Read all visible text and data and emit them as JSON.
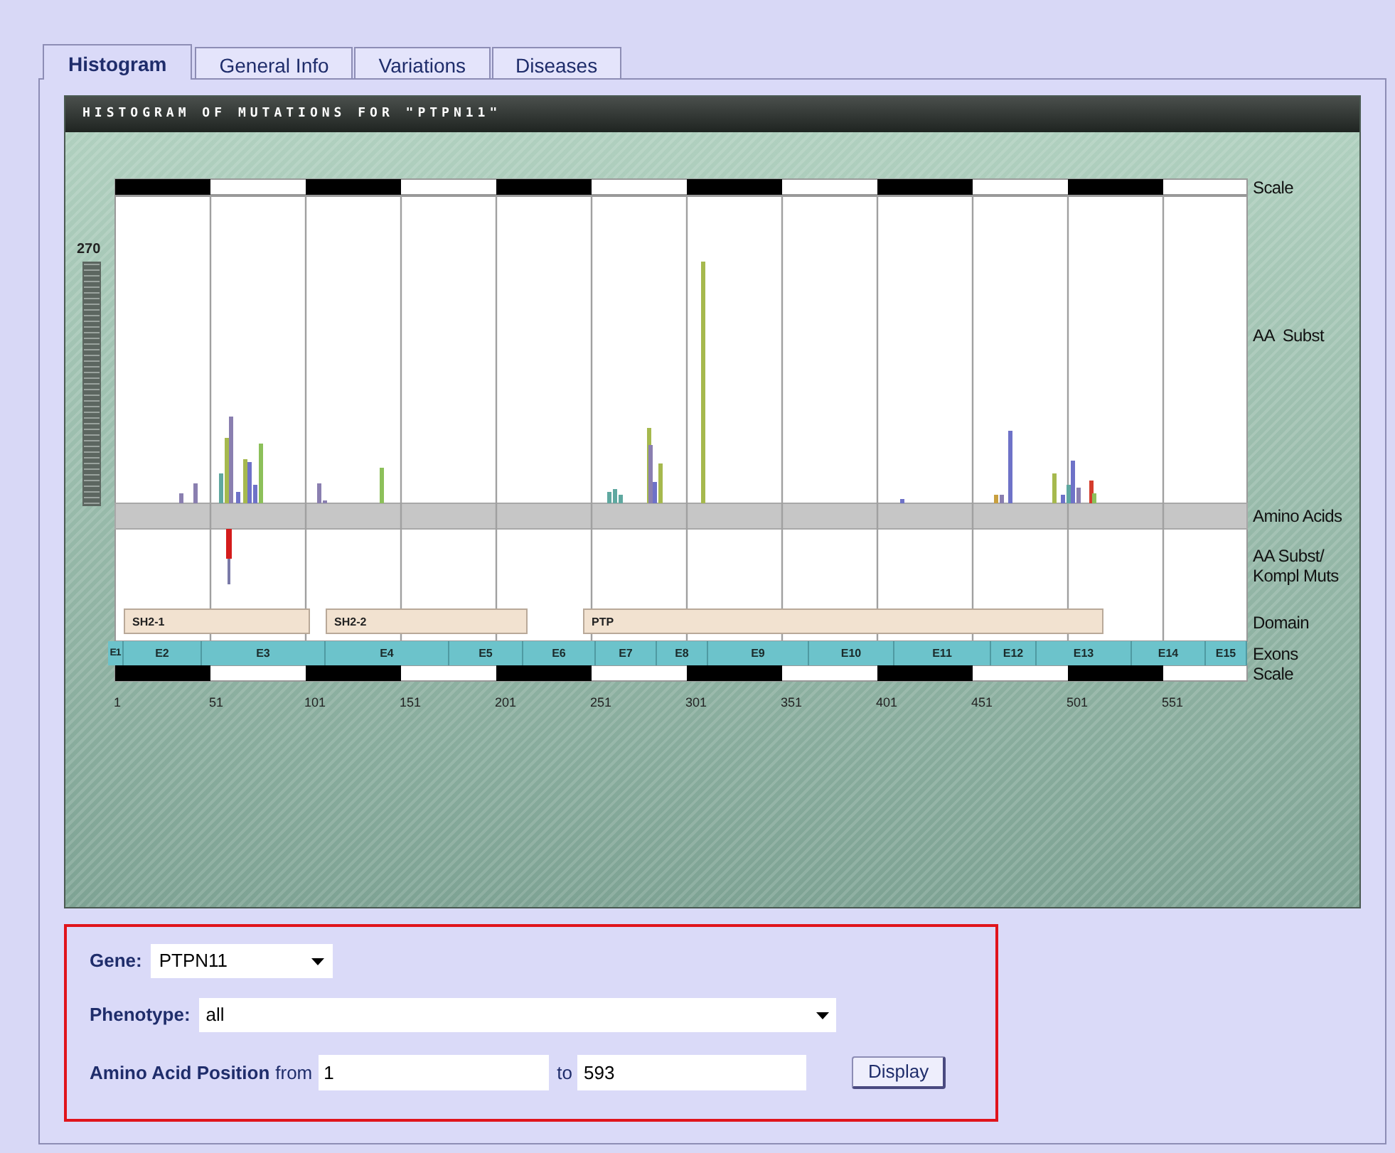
{
  "tabs": [
    {
      "label": "Histogram",
      "selected": true
    },
    {
      "label": "General Info",
      "selected": false
    },
    {
      "label": "Variations",
      "selected": false
    },
    {
      "label": "Diseases",
      "selected": false
    }
  ],
  "histogram": {
    "title": "HISTOGRAM OF MUTATIONS FOR \"PTPN11\"",
    "y_max_label": "270",
    "track_labels": [
      "Scale",
      "AA  Subst",
      "Amino Acids",
      "AA Subst/ Kompl Muts",
      "Domain",
      "Exons",
      "Scale"
    ],
    "domains": [
      "SH2-1",
      "SH2-2",
      "PTP"
    ],
    "exons": [
      "E1",
      "E2",
      "E3",
      "E4",
      "E5",
      "E6",
      "E7",
      "E8",
      "E9",
      "E10",
      "E11",
      "E12",
      "E13",
      "E14",
      "E15"
    ],
    "x_ticks": [
      "1",
      "51",
      "101",
      "151",
      "201",
      "251",
      "301",
      "351",
      "401",
      "451",
      "501",
      "551"
    ]
  },
  "form": {
    "gene": {
      "label": "Gene:",
      "value": "PTPN11"
    },
    "phenotype": {
      "label": "Phenotype:",
      "value": "all"
    },
    "position": {
      "label": "Amino Acid Position",
      "from_label": "from",
      "from_value": "1",
      "to_label": "to",
      "to_value": "593"
    },
    "button": "Display"
  }
}
